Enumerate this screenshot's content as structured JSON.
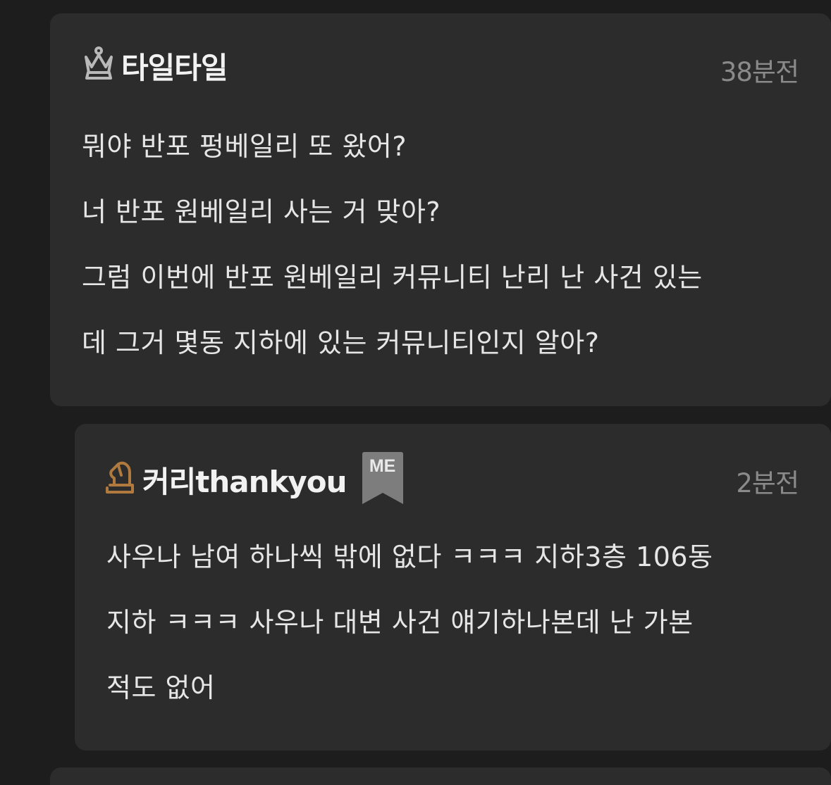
{
  "post": {
    "author": {
      "name": "타일타일",
      "icon": "queen-chess-icon",
      "icon_color": "#b9b9b9"
    },
    "time": "38분전",
    "lines": [
      "뭐야 반포 펑베일리 또 왔어?",
      "너 반포 원베일리 사는 거 맞아?",
      "그럼 이번에 반포 원베일리 커뮤니티 난리 난 사건 있는",
      "데 그거 몇동 지하에 있는 커뮤니티인지 알아?"
    ]
  },
  "reply": {
    "author": {
      "name": "커리thankyou",
      "icon": "knight-chess-icon",
      "icon_color": "#b07a3f",
      "badge": "ME"
    },
    "time": "2분전",
    "lines": [
      "사우나 남여 하나씩 밖에 없다 ㅋㅋㅋ 지하3층 106동",
      "지하 ㅋㅋㅋ 사우나 대변 사건 얘기하나본데 난 가본",
      "적도 없어"
    ]
  },
  "colors": {
    "background": "#1d1d1d",
    "card": "#2c2c2c",
    "text": "#e6e6e6",
    "muted": "#8a8a8a",
    "badge": "#7d7d7d"
  }
}
